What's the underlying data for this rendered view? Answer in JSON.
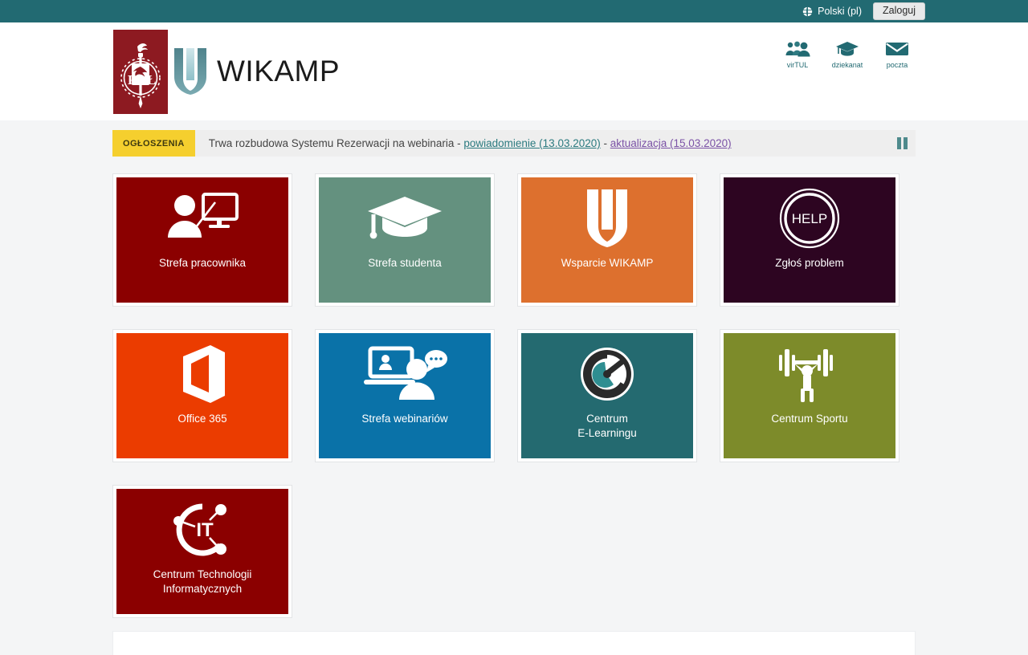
{
  "topbar": {
    "language_label": "Polski (pl)",
    "language_icon": "globe-icon",
    "login_label": "Zaloguj"
  },
  "header": {
    "brand_text": "WIKAMP",
    "crest_letters": [
      "P",
      "Ł"
    ],
    "quick_links": [
      {
        "caption": "virTUL",
        "icon": "people-group-icon"
      },
      {
        "caption": "dziekanat",
        "icon": "graduation-cap-icon"
      },
      {
        "caption": "poczta",
        "icon": "envelope-icon"
      }
    ]
  },
  "announcement": {
    "badge": "OGŁOSZENIA",
    "text_before": "Trwa rozbudowa Systemu Rezerwacji na webinaria - ",
    "link_1": "powiadomienie (13.03.2020)",
    "separator": " - ",
    "link_2": "aktualizacja (15.03.2020)",
    "pause_icon": "pause-icon",
    "link_1_color": "#2b7a7f",
    "link_2_color": "#7b52a6",
    "badge_color": "#f5cf2e"
  },
  "tiles": [
    {
      "label": "Strefa pracownika",
      "color": "#8b0000",
      "icon": "person-presenting-monitor-icon"
    },
    {
      "label": "Strefa studenta",
      "color": "#64917f",
      "icon": "graduation-cap-icon"
    },
    {
      "label": "Wsparcie WIKAMP",
      "color": "#dd702e",
      "icon": "wikamp-u-icon"
    },
    {
      "label": "Zgłoś problem",
      "color": "#2d0521",
      "icon": "help-circle-icon",
      "icon_text": "HELP"
    },
    {
      "label": "Office 365",
      "color": "#eb3c00",
      "icon": "office-logo-icon"
    },
    {
      "label": "Strefa webinariów",
      "color": "#0a72a8",
      "icon": "webinar-laptop-person-icon"
    },
    {
      "label": "Centrum E-Learningu",
      "label_line_1": "Centrum",
      "label_line_2": "E-Learningu",
      "color": "#246a70",
      "icon": "e-learning-circle-icon"
    },
    {
      "label": "Centrum Sportu",
      "color": "#7d8b2a",
      "icon": "weightlifter-icon"
    },
    {
      "label": "Centrum Technologii Informatycznych",
      "label_line_1": "Centrum Technologii",
      "label_line_2": "Informatycznych",
      "color": "#8b0000",
      "icon": "it-network-icon",
      "icon_text": "IT"
    }
  ]
}
